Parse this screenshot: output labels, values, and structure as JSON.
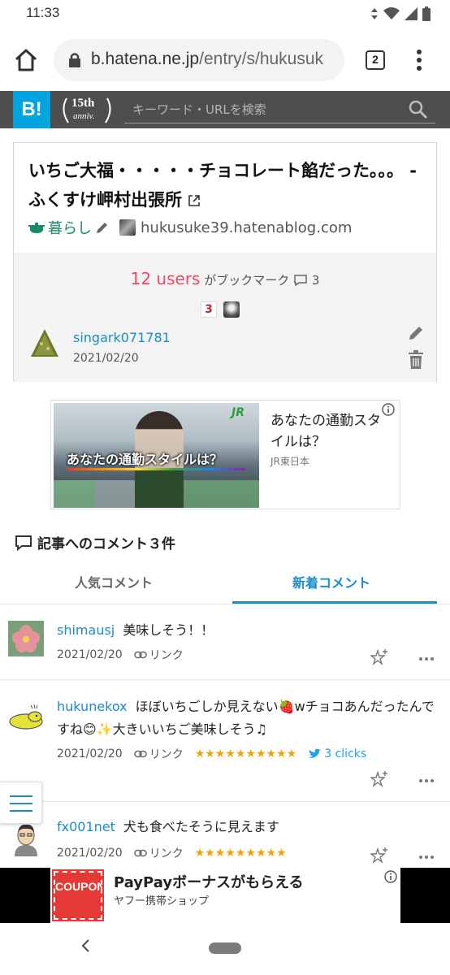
{
  "status": {
    "time": "11:33"
  },
  "browser": {
    "url_host": "b.hatena.ne.jp",
    "url_path": "/entry/s/hukusuk",
    "tab_count": "2"
  },
  "header": {
    "logo": "B!",
    "anniv_main": "15th",
    "anniv_sub": "anniv.",
    "search_placeholder": "キーワード・URLを検索"
  },
  "entry": {
    "title": "いちご大福・・・・・チョコレート餡だった。。。 - ふくすけ岬村出張所",
    "category": "暮らし",
    "site": "hukusuke39.hatenablog.com",
    "users_count": "12 users",
    "users_suffix": "がブックマーク",
    "comment_count": "3",
    "badge_count": "3",
    "bookmarker": {
      "name": "singark071781",
      "date": "2021/02/20"
    }
  },
  "ad": {
    "headline": "あなたの通勤スタイルは？",
    "caption": "あなたの通勤スタイルは？",
    "sponsor": "JR東日本",
    "logo": "JR"
  },
  "comments_section": {
    "title": "記事へのコメント３件",
    "tabs": [
      {
        "label": "人気コメント"
      },
      {
        "label": "新着コメント"
      }
    ],
    "active_tab": "新着コメント",
    "link_label": "リンク",
    "comments": [
      {
        "user": "shimausj",
        "text": "美味しそう！！",
        "date": "2021/02/20",
        "stars": "",
        "clicks": ""
      },
      {
        "user": "hukunekox",
        "text": "ほぼいちごしか見えない🍓wチョコあんだったんですね😊✨大きいいちご美味しそう♫",
        "date": "2021/02/20",
        "stars": "★★★★★★★★★★",
        "clicks": "3 clicks"
      },
      {
        "user": "fx001net",
        "text": "犬も食べたそうに見えます",
        "date": "2021/02/20",
        "stars": "★★★★★★★★★",
        "clicks": ""
      }
    ]
  },
  "bottom_ad": {
    "coupon": "COUPON",
    "headline": "PayPayボーナスがもらえる",
    "sub": "ヤフー携帯ショップ"
  },
  "colors": {
    "hatena_blue": "#00a4de",
    "link_blue": "#1a8cc8",
    "users_pink": "#f04860",
    "star_orange": "#f0a20a"
  }
}
